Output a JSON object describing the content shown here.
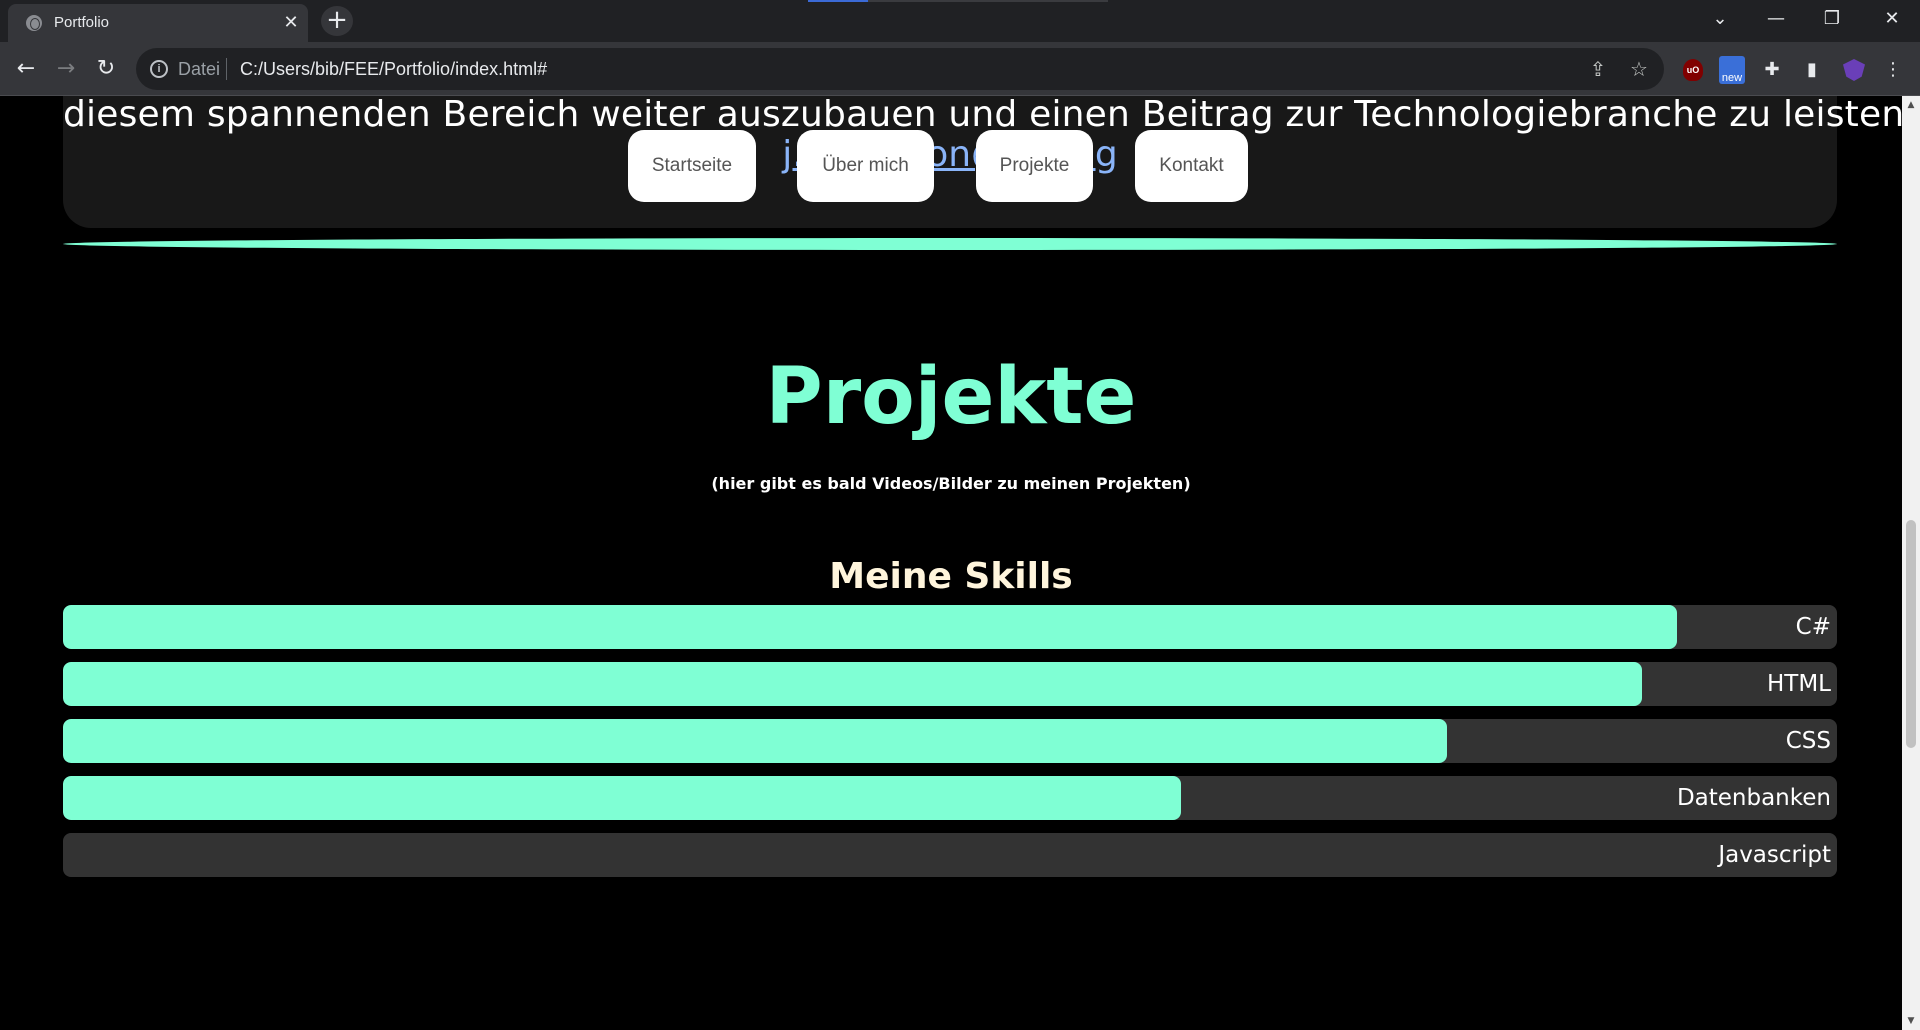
{
  "browser": {
    "tab_title": "Portfolio",
    "tab_close": "✕",
    "new_tab": "+",
    "url_scheme_label": "Datei",
    "url": "C:/Users/bib/FEE/Portfolio/index.html#",
    "ext_ublock": "uO",
    "ext_new_badge": "new"
  },
  "page": {
    "about_text": "diesem spannenden Bereich weiter auszubauen und einen Beitrag zur Technologiebranche zu leisten.",
    "about_link": "j.i.bolation@go.leg",
    "nav": {
      "home": "Startseite",
      "about": "Über mich",
      "projects": "Projekte",
      "contact": "Kontakt"
    },
    "projects_title": "Projekte",
    "projects_subtitle": "(hier gibt es bald Videos/Bilder zu meinen Projekten)",
    "skills_title": "Meine Skills",
    "skills": [
      {
        "name": "C#",
        "level": 0.91
      },
      {
        "name": "HTML",
        "level": 0.89
      },
      {
        "name": "CSS",
        "level": 0.78
      },
      {
        "name": "Datenbanken",
        "level": 0.63
      },
      {
        "name": "Javascript",
        "level": 0.0
      }
    ]
  },
  "colors": {
    "accent": "#7fffd4",
    "card_bg": "#181818",
    "bar_track": "#333333",
    "page_bg": "#000000"
  }
}
